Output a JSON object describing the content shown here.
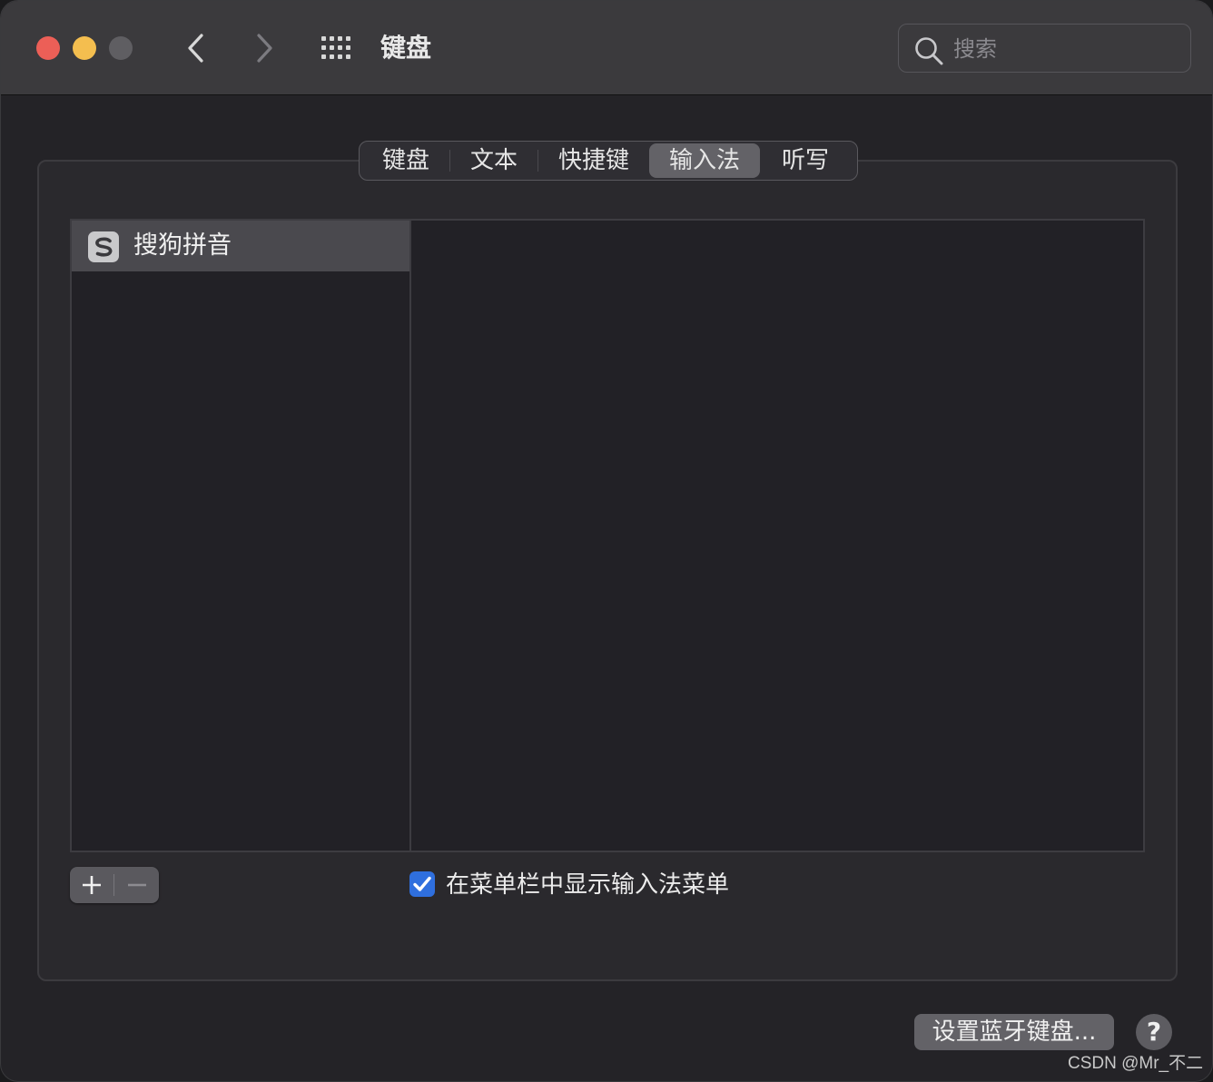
{
  "window": {
    "title": "键盘",
    "colors": {
      "close": "#ec5f57",
      "minimize": "#f4be4f",
      "maximize_disabled": "#5f5e62",
      "accent": "#2f6fde"
    }
  },
  "toolbar": {
    "back_icon": "chevron-left-icon",
    "forward_icon": "chevron-right-icon",
    "grid_icon": "grid-icon",
    "search": {
      "placeholder": "搜索",
      "value": ""
    }
  },
  "tabs": [
    {
      "label": "键盘",
      "active": false
    },
    {
      "label": "文本",
      "active": false
    },
    {
      "label": "快捷键",
      "active": false
    },
    {
      "label": "输入法",
      "active": true
    },
    {
      "label": "听写",
      "active": false
    }
  ],
  "input_sources": {
    "items": [
      {
        "label": "搜狗拼音",
        "icon": "sogou-icon",
        "selected": true
      }
    ]
  },
  "controls": {
    "add_label": "+",
    "remove_label": "−",
    "show_menu_checkbox": {
      "label": "在菜单栏中显示输入法菜单",
      "checked": true
    }
  },
  "footer": {
    "bluetooth_button": "设置蓝牙键盘...",
    "help_button": "?"
  },
  "watermark": "CSDN @Mr_不二"
}
